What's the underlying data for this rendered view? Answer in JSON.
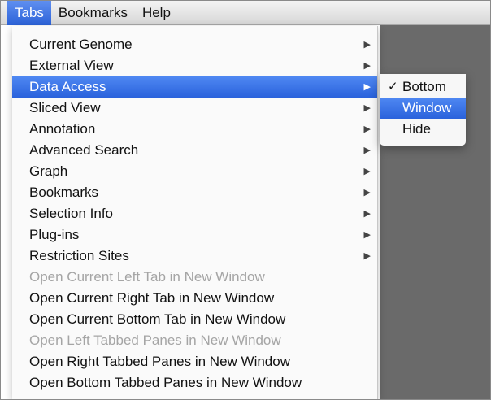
{
  "menubar": {
    "items": [
      {
        "label": "Tabs",
        "active": true
      },
      {
        "label": "Bookmarks",
        "active": false
      },
      {
        "label": "Help",
        "active": false
      }
    ]
  },
  "tabs_menu": {
    "items": [
      {
        "label": "Current Genome",
        "submenu": true,
        "disabled": false,
        "highlighted": false
      },
      {
        "label": "External View",
        "submenu": true,
        "disabled": false,
        "highlighted": false
      },
      {
        "label": "Data Access",
        "submenu": true,
        "disabled": false,
        "highlighted": true
      },
      {
        "label": "Sliced View",
        "submenu": true,
        "disabled": false,
        "highlighted": false
      },
      {
        "label": "Annotation",
        "submenu": true,
        "disabled": false,
        "highlighted": false
      },
      {
        "label": "Advanced Search",
        "submenu": true,
        "disabled": false,
        "highlighted": false
      },
      {
        "label": "Graph",
        "submenu": true,
        "disabled": false,
        "highlighted": false
      },
      {
        "label": "Bookmarks",
        "submenu": true,
        "disabled": false,
        "highlighted": false
      },
      {
        "label": "Selection Info",
        "submenu": true,
        "disabled": false,
        "highlighted": false
      },
      {
        "label": "Plug-ins",
        "submenu": true,
        "disabled": false,
        "highlighted": false
      },
      {
        "label": "Restriction Sites",
        "submenu": true,
        "disabled": false,
        "highlighted": false
      },
      {
        "label": "Open Current Left Tab in New Window",
        "submenu": false,
        "disabled": true,
        "highlighted": false
      },
      {
        "label": "Open Current Right Tab in New Window",
        "submenu": false,
        "disabled": false,
        "highlighted": false
      },
      {
        "label": "Open Current Bottom Tab in New Window",
        "submenu": false,
        "disabled": false,
        "highlighted": false
      },
      {
        "label": "Open Left Tabbed Panes in New Window",
        "submenu": false,
        "disabled": true,
        "highlighted": false
      },
      {
        "label": "Open Right Tabbed Panes in New Window",
        "submenu": false,
        "disabled": false,
        "highlighted": false
      },
      {
        "label": "Open Bottom Tabbed Panes in New Window",
        "submenu": false,
        "disabled": false,
        "highlighted": false
      }
    ]
  },
  "data_access_submenu": {
    "items": [
      {
        "label": "Bottom",
        "checked": true,
        "highlighted": false
      },
      {
        "label": "Window",
        "checked": false,
        "highlighted": true
      },
      {
        "label": "Hide",
        "checked": false,
        "highlighted": false
      }
    ]
  },
  "icons": {
    "submenu_arrow": "▶",
    "check": "✓"
  },
  "colors": {
    "highlight": "#3a72e6",
    "disabled_text": "#a5a5a5",
    "background_dark": "#6a6a6a"
  }
}
